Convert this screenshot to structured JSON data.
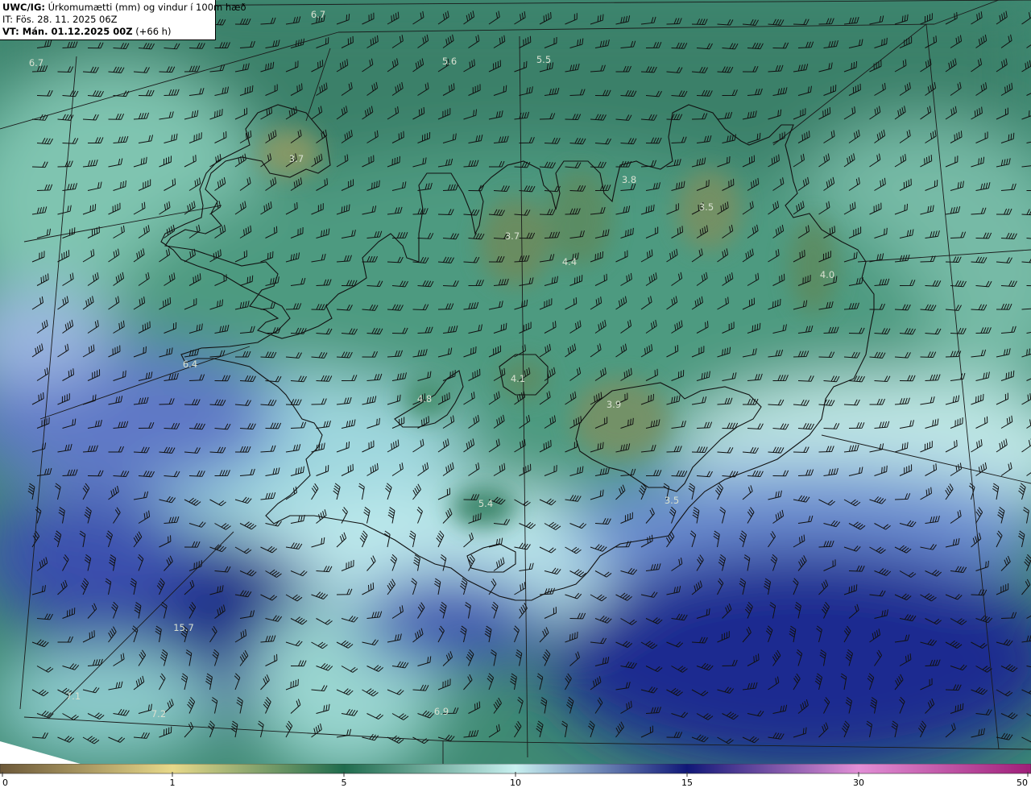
{
  "header": {
    "product_code": "UWC/IG:",
    "product_title": "Úrkomumætti (mm) og vindur í 100m hæð",
    "issue_time": "IT: Fös. 28. 11. 2025 06Z",
    "valid_label": "VT: Mán. 01.12.2025 00Z",
    "lead_time": "(+66 h)"
  },
  "value_labels": [
    "6.7",
    "6.7",
    "5.6",
    "5.5",
    "3.7",
    "3.8",
    "3.5",
    "3.7",
    "4.4",
    "4.0",
    "6.4",
    "4.1",
    "4.8",
    "3.9",
    "5.4",
    "3.5",
    "15.7",
    "7.1",
    "7.2",
    "6.9"
  ],
  "colorbar": {
    "ticks": [
      "0",
      "1",
      "5",
      "10",
      "15",
      "30",
      "50"
    ],
    "stops": [
      {
        "value": "0",
        "color": "#6e5a3a"
      },
      {
        "value": "1",
        "color": "#e8d98a"
      },
      {
        "value": "5",
        "color": "#1f6b4d"
      },
      {
        "value": "10",
        "color": "#c8f0f0"
      },
      {
        "value": "15",
        "color": "#101878"
      },
      {
        "value": "30",
        "color": "#e28fd6"
      },
      {
        "value": "50",
        "color": "#a0207a"
      }
    ]
  }
}
